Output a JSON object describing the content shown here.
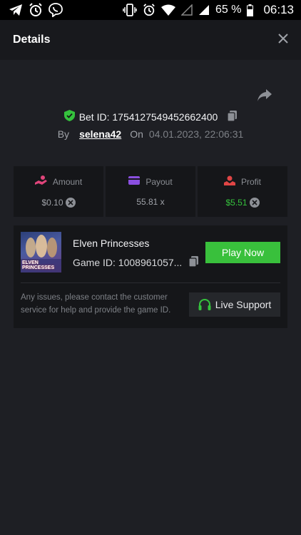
{
  "statusbar": {
    "battery_percent": "65 %",
    "time": "06:13",
    "icons": [
      "telegram-icon",
      "alarm-icon",
      "viber-icon",
      "vibrate-icon",
      "alarm-icon",
      "wifi-icon",
      "signal-icon",
      "signal-icon",
      "battery-icon"
    ]
  },
  "header": {
    "title": "Details",
    "close_icon": "close-icon"
  },
  "bet": {
    "id_label": "Bet ID: 1754127549452662400",
    "by_label": "By",
    "username": "selena42",
    "on_label": "On",
    "date": "04.01.2023, 22:06:31"
  },
  "stats": {
    "amount": {
      "label": "Amount",
      "value": "$0.10"
    },
    "payout": {
      "label": "Payout",
      "value": "55.81 x"
    },
    "profit": {
      "label": "Profit",
      "value": "$5.51"
    }
  },
  "game": {
    "title": "Elven Princesses",
    "game_id": "Game ID: 1008961057...",
    "thumb_text": "ELVEN PRINCESSES",
    "play_label": "Play Now",
    "support_text": "Any issues, please contact the customer service for help and provide the game ID.",
    "support_label": "Live Support"
  },
  "colors": {
    "accent_green": "#39c03c",
    "profit_green": "#35c23d",
    "amount_icon": "#e0457b",
    "payout_icon": "#8a4fe0",
    "profit_icon": "#e04545"
  }
}
